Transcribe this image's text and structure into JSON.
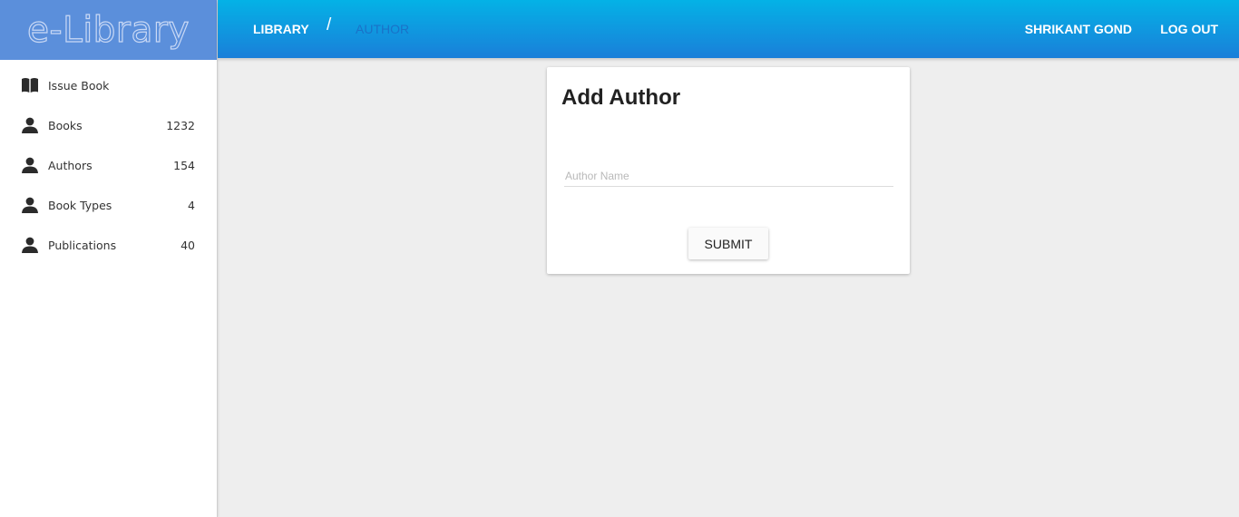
{
  "brand": {
    "logo_text": "e-Library"
  },
  "header": {
    "breadcrumb": {
      "library": "LIBRARY",
      "separator": "/",
      "current": "AUTHOR"
    },
    "user_name": "SHRIKANT GOND",
    "logout": "LOG OUT"
  },
  "sidebar": {
    "items": [
      {
        "label": "Issue Book",
        "count": "",
        "icon": "book-icon"
      },
      {
        "label": "Books",
        "count": "1232",
        "icon": "person-icon"
      },
      {
        "label": "Authors",
        "count": "154",
        "icon": "person-icon"
      },
      {
        "label": "Book Types",
        "count": "4",
        "icon": "person-icon"
      },
      {
        "label": "Publications",
        "count": "40",
        "icon": "person-icon"
      }
    ]
  },
  "form": {
    "title": "Add Author",
    "author_name": {
      "value": "",
      "placeholder": "Author Name"
    },
    "submit_label": "SUBMIT"
  },
  "colors": {
    "header_top": "#04b2e6",
    "header_bottom": "#1a7fd9",
    "logo_bg": "#5b8fdb",
    "page_bg": "#eeeeee"
  }
}
